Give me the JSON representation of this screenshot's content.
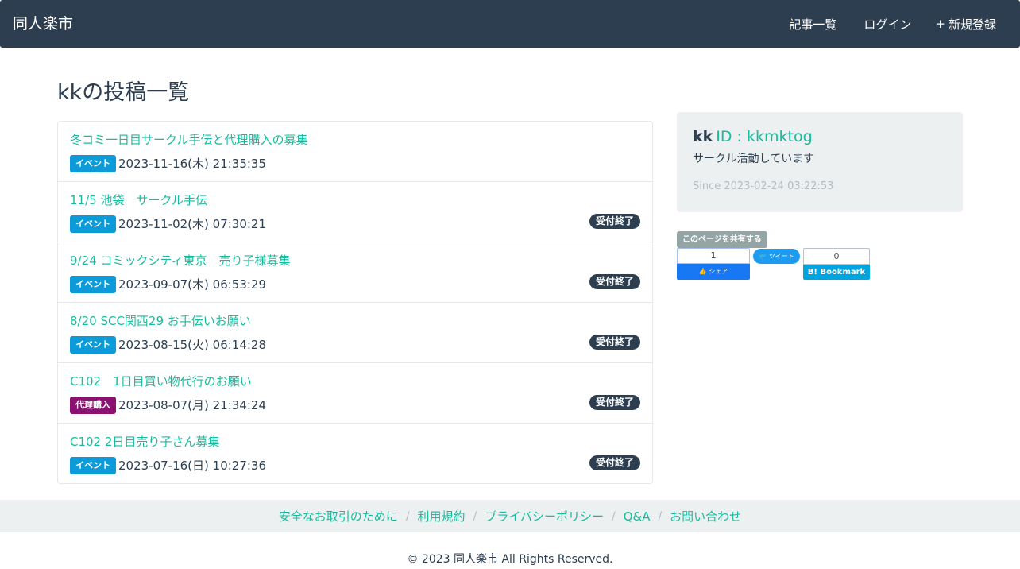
{
  "navbar": {
    "brand": "同人楽市",
    "items": [
      {
        "icon": "",
        "label": "記事一覧"
      },
      {
        "icon": "",
        "label": "ログイン"
      },
      {
        "icon": "+",
        "label": "新規登録"
      }
    ]
  },
  "page": {
    "title": "kkの投稿一覧"
  },
  "posts": [
    {
      "title": "冬コミ一日目サークル手伝と代理購入の募集",
      "category": "イベント",
      "date": "2023-11-16(木) 21:35:35",
      "status": ""
    },
    {
      "title": "11/5 池袋　サークル手伝",
      "category": "イベント",
      "date": "2023-11-02(木) 07:30:21",
      "status": "受付終了"
    },
    {
      "title": "9/24 コミックシティ東京　売り子様募集",
      "category": "イベント",
      "date": "2023-09-07(木) 06:53:29",
      "status": "受付終了"
    },
    {
      "title": "8/20 SCC関西29 お手伝いお願い",
      "category": "イベント",
      "date": "2023-08-15(火) 06:14:28",
      "status": "受付終了"
    },
    {
      "title": "C102　1日目買い物代行のお願い",
      "category": "代理購入",
      "date": "2023-08-07(月) 21:34:24",
      "status": "受付終了"
    },
    {
      "title": "C102 2日目売り子さん募集",
      "category": "イベント",
      "date": "2023-07-16(日) 10:27:36",
      "status": "受付終了"
    }
  ],
  "profile": {
    "icon": "",
    "name": "kk",
    "id_label": "ID : kkmktog",
    "description": "サークル活動しています",
    "since_icon": "",
    "since": "Since 2023-02-24 03:22:53"
  },
  "share": {
    "label": "このページを共有する",
    "facebook_count": "1",
    "facebook_button": "👍 シェア",
    "twitter_button": "🐦 ツイート",
    "hatena_count": "0",
    "hatena_button": "B! Bookmark"
  },
  "footer": {
    "links": [
      "安全なお取引のために",
      "利用規約",
      "プライバシーポリシー",
      "Q&A",
      "お問い合わせ"
    ],
    "separator": "/",
    "copyright": "© 2023 同人楽市 All Rights Reserved."
  },
  "colors": {
    "navbar": "#2c3e50",
    "link": "#18bc9c",
    "badge_event": "#0d9ad9",
    "badge_proxy": "#8a1170",
    "closed_badge": "#2c3e50"
  }
}
